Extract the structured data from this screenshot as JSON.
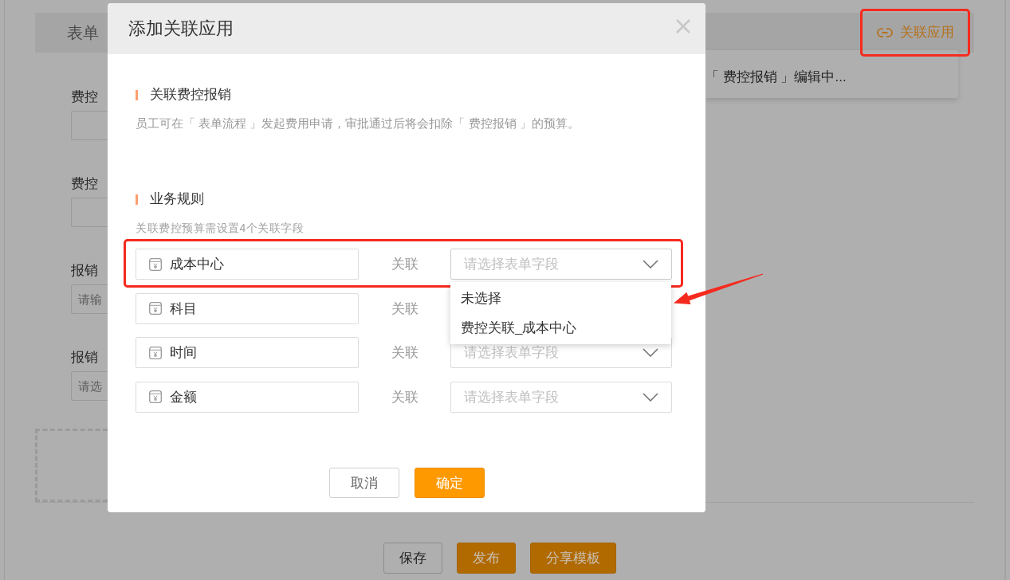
{
  "page": {
    "header": {
      "title": "表单",
      "link": {
        "label": "关联应用",
        "highlighted": true
      }
    },
    "status_popover": {
      "text": "「 费控报销 」编辑中..."
    },
    "form_fields": [
      {
        "label": "费控"
      },
      {
        "label": "费控"
      },
      {
        "label": "报销",
        "placeholder": "请输"
      },
      {
        "label": "报销",
        "placeholder": "请选"
      }
    ],
    "buttons": [
      {
        "label": "保存",
        "kind": "secondary"
      },
      {
        "label": "发布",
        "kind": "primary"
      },
      {
        "label": "分享模板",
        "kind": "primary"
      }
    ]
  },
  "dialog": {
    "title": "添加关联应用",
    "sections": [
      {
        "title": "关联费控报销",
        "description": "员工可在「 表单流程 」发起费用申请，审批通过后将会扣除「 费控报销 」的预算。"
      },
      {
        "title": "业务规则",
        "hint": "关联费控预算需设置4个关联字段"
      }
    ],
    "rows": [
      {
        "field": "成本中心",
        "relation": "关联",
        "placeholder": "请选择表单字段",
        "expanded": true,
        "highlighted": true,
        "options": [
          {
            "label": "未选择",
            "selected": false
          },
          {
            "label": "费控关联_成本中心",
            "selected": false
          }
        ]
      },
      {
        "field": "科目",
        "relation": "关联",
        "expanded": false,
        "highlighted": false
      },
      {
        "field": "时间",
        "relation": "关联",
        "placeholder": "请选择表单字段",
        "expanded": false,
        "highlighted": false
      },
      {
        "field": "金额",
        "relation": "关联",
        "placeholder": "请选择表单字段",
        "expanded": false,
        "highlighted": false
      }
    ],
    "buttons": [
      {
        "label": "取消",
        "kind": "secondary"
      },
      {
        "label": "确定",
        "kind": "primary"
      }
    ]
  },
  "callout_arrow": true
}
